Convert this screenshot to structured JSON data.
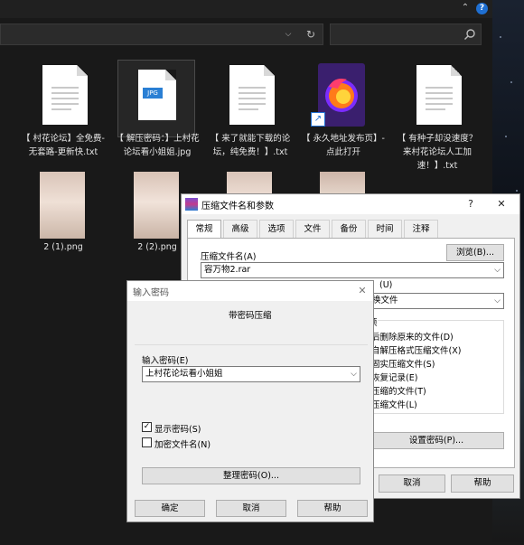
{
  "explorer": {
    "files": [
      {
        "name": "【 村花论坛】全免费-无套路-更新快.txt",
        "type": "txt"
      },
      {
        "name": "【 解压密码：】上村花论坛看小姐姐.jpg",
        "type": "jpg",
        "badge": "JPG"
      },
      {
        "name": "【 来了就能下载的论坛，纯免费！】.txt",
        "type": "txt"
      },
      {
        "name": "【 永久地址发布页】-点此打开",
        "type": "link"
      },
      {
        "name": "【 有种子却没速度？来村花论坛人工加速！】.txt",
        "type": "txt"
      },
      {
        "name": "2 (1).png",
        "type": "png"
      },
      {
        "name": "2 (2).png",
        "type": "png"
      },
      {
        "name": "",
        "type": "png"
      },
      {
        "name": "",
        "type": "png"
      }
    ]
  },
  "archive_dialog": {
    "title": "压缩文件名和参数",
    "help_btn": "?",
    "close_btn": "✕",
    "tabs": [
      "常规",
      "高级",
      "选项",
      "文件",
      "备份",
      "时间",
      "注释"
    ],
    "filename_label": "压缩文件名(A)",
    "browse_btn": "浏览(B)...",
    "filename_value": "容万物2.rar",
    "update_label_tail": "(U)",
    "update_value_tail": "换文件",
    "options_header_tail": "项",
    "options": [
      "后删除原来的文件(D)",
      "自解压格式压缩文件(X)",
      "固实压缩文件(S)",
      "恢复记录(E)",
      "压缩的文件(T)",
      "压缩文件(L)"
    ],
    "set_password_btn": "设置密码(P)...",
    "cancel_btn": "取消",
    "help_button": "帮助"
  },
  "password_dialog": {
    "title": "输入密码",
    "close_btn": "✕",
    "heading": "带密码压缩",
    "password_label": "输入密码(E)",
    "password_value": "上村花论坛看小姐姐",
    "show_password_label": "显示密码(S)",
    "show_password_checked": true,
    "encrypt_names_label": "加密文件名(N)",
    "encrypt_names_checked": false,
    "organize_btn": "整理密码(O)...",
    "ok_btn": "确定",
    "cancel_btn": "取消",
    "help_btn": "帮助"
  }
}
